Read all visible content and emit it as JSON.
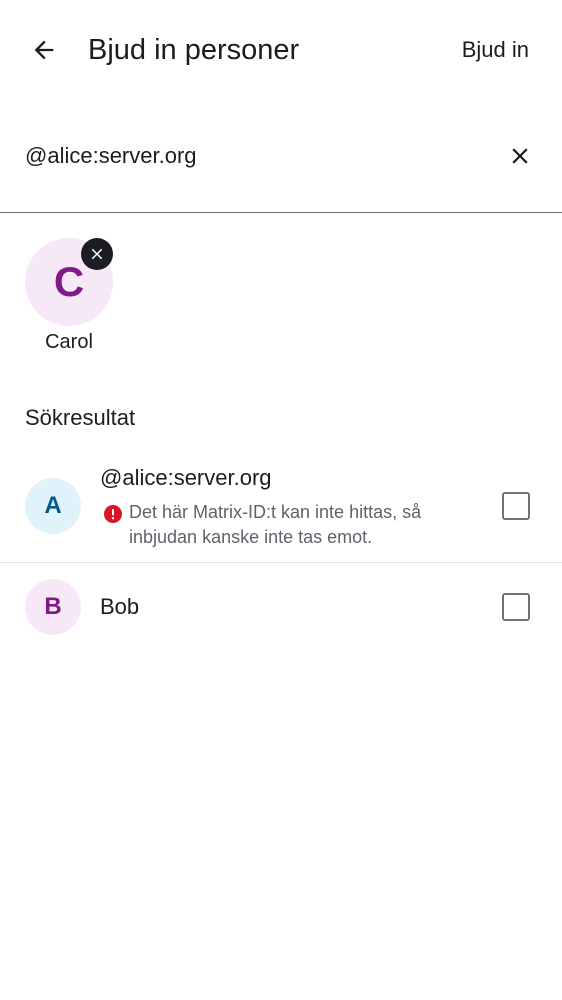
{
  "header": {
    "title": "Bjud in personer",
    "invite_action": "Bjud in"
  },
  "search": {
    "value": "@alice:server.org"
  },
  "selected_users": [
    {
      "initial": "C",
      "name": "Carol"
    }
  ],
  "results": {
    "section_title": "Sökresultat",
    "items": [
      {
        "initial": "A",
        "name": "@alice:server.org",
        "warning": "Det här Matrix-ID:t kan inte hittas, så inbjudan kanske inte tas emot.",
        "checked": false
      },
      {
        "initial": "B",
        "name": "Bob",
        "checked": false
      }
    ]
  },
  "icons": {
    "back": "arrow-back-icon",
    "clear": "close-icon",
    "remove_selected": "close-icon",
    "warning": "error-icon"
  },
  "colors": {
    "avatar_purple_bg": "#f7e8f7",
    "avatar_purple_fg": "#7f1a86",
    "avatar_blue_bg": "#e1f3fa",
    "avatar_blue_fg": "#005c8b",
    "error": "#d51928"
  }
}
